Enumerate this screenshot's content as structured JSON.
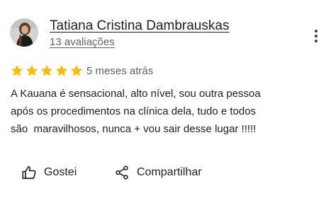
{
  "review": {
    "reviewer_name": "Tatiana Cristina Dambrauskas",
    "review_count": "13 avaliações",
    "rating": 5,
    "rating_max": 5,
    "date": "5 meses atrás",
    "text_lines": [
      "A Kauana é sensacional, alto nível, sou outra pessoa",
      "após os procedimentos na clínica dela, tudo e todos",
      "são  maravilhosos, nunca + vou sair desse lugar !!!!!"
    ]
  },
  "actions": {
    "like_label": "Gostei",
    "share_label": "Compartilhar"
  },
  "icons": {
    "avatar": "avatar-photo",
    "more": "more-vert-icon",
    "star": "star-icon",
    "like": "thumb-up-icon",
    "share": "share-icon"
  },
  "colors": {
    "star": "#FBBC04",
    "text": "#202124",
    "secondary_text": "#5f6368"
  }
}
